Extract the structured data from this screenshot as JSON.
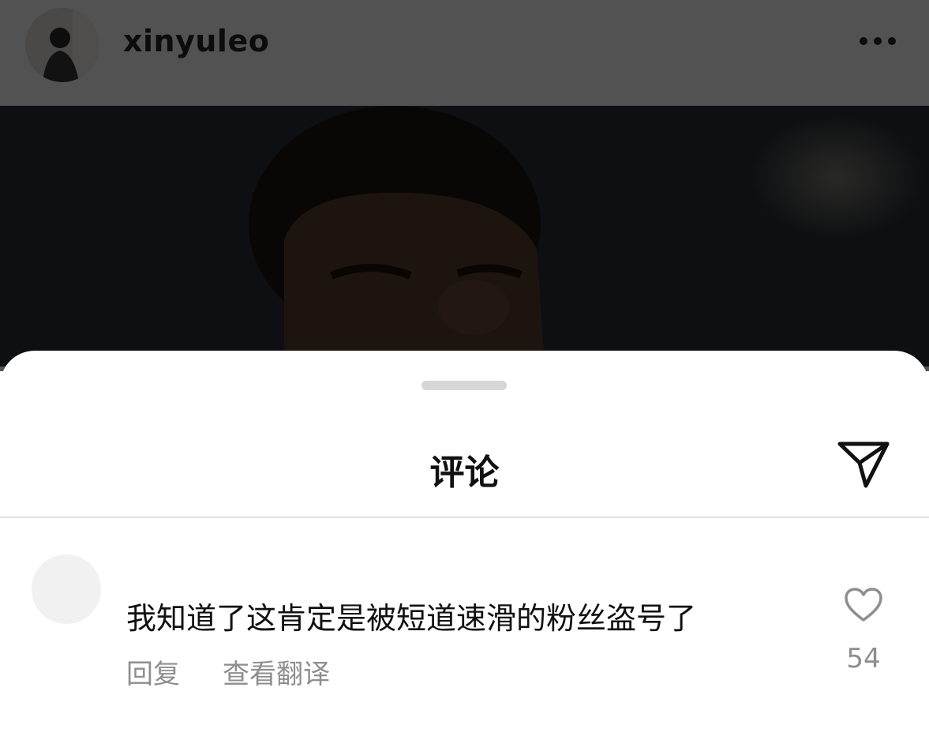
{
  "post": {
    "username": "xinyuleo",
    "more_icon": "more-horizontal-icon"
  },
  "comments_sheet": {
    "title": "评论",
    "share_icon": "send-icon",
    "comments": [
      {
        "username": "",
        "text": "我知道了这肯定是被短道速滑的粉丝盗号了",
        "reply_label": "回复",
        "translate_label": "查看翻译",
        "like_icon": "heart-icon",
        "likes": "54"
      }
    ]
  },
  "colors": {
    "overlay": "#000000",
    "text_primary": "#111111",
    "text_secondary": "#8e8e8e",
    "divider": "#e3e3e3"
  }
}
